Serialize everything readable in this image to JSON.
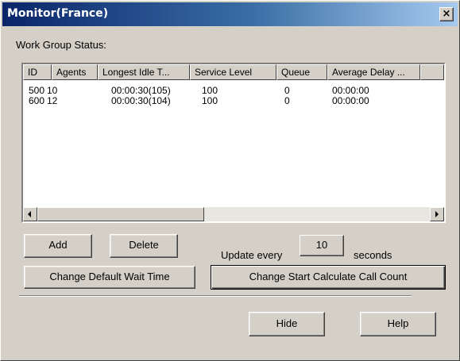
{
  "window": {
    "title": "Monitor(France)",
    "close_glyph": "×"
  },
  "status_label": "Work Group Status:",
  "table": {
    "columns": [
      "ID",
      "Agents",
      "Longest Idle T...",
      "Service Level",
      "Queue",
      "Average Delay ..."
    ],
    "rows": [
      [
        "500",
        "10",
        "00:00:30(105)",
        "100",
        "0",
        "00:00:00"
      ],
      [
        "600",
        "12",
        "00:00:30(104)",
        "100",
        "0",
        "00:00:00"
      ]
    ]
  },
  "buttons": {
    "add": "Add",
    "delete": "Delete",
    "change_default_wait_time": "Change Default Wait Time",
    "change_start_calculate_call_count": "Change Start Calculate Call Count",
    "hide": "Hide",
    "help": "Help"
  },
  "update": {
    "prefix": "Update every",
    "interval": "10",
    "suffix": "seconds"
  },
  "icons": {
    "close": "close-icon",
    "scroll_left": "arrow-left-icon",
    "scroll_right": "arrow-right-icon"
  },
  "colors": {
    "titlebar_start": "#0a246a",
    "titlebar_end": "#a6caf0",
    "face": "#d4d0c8"
  }
}
